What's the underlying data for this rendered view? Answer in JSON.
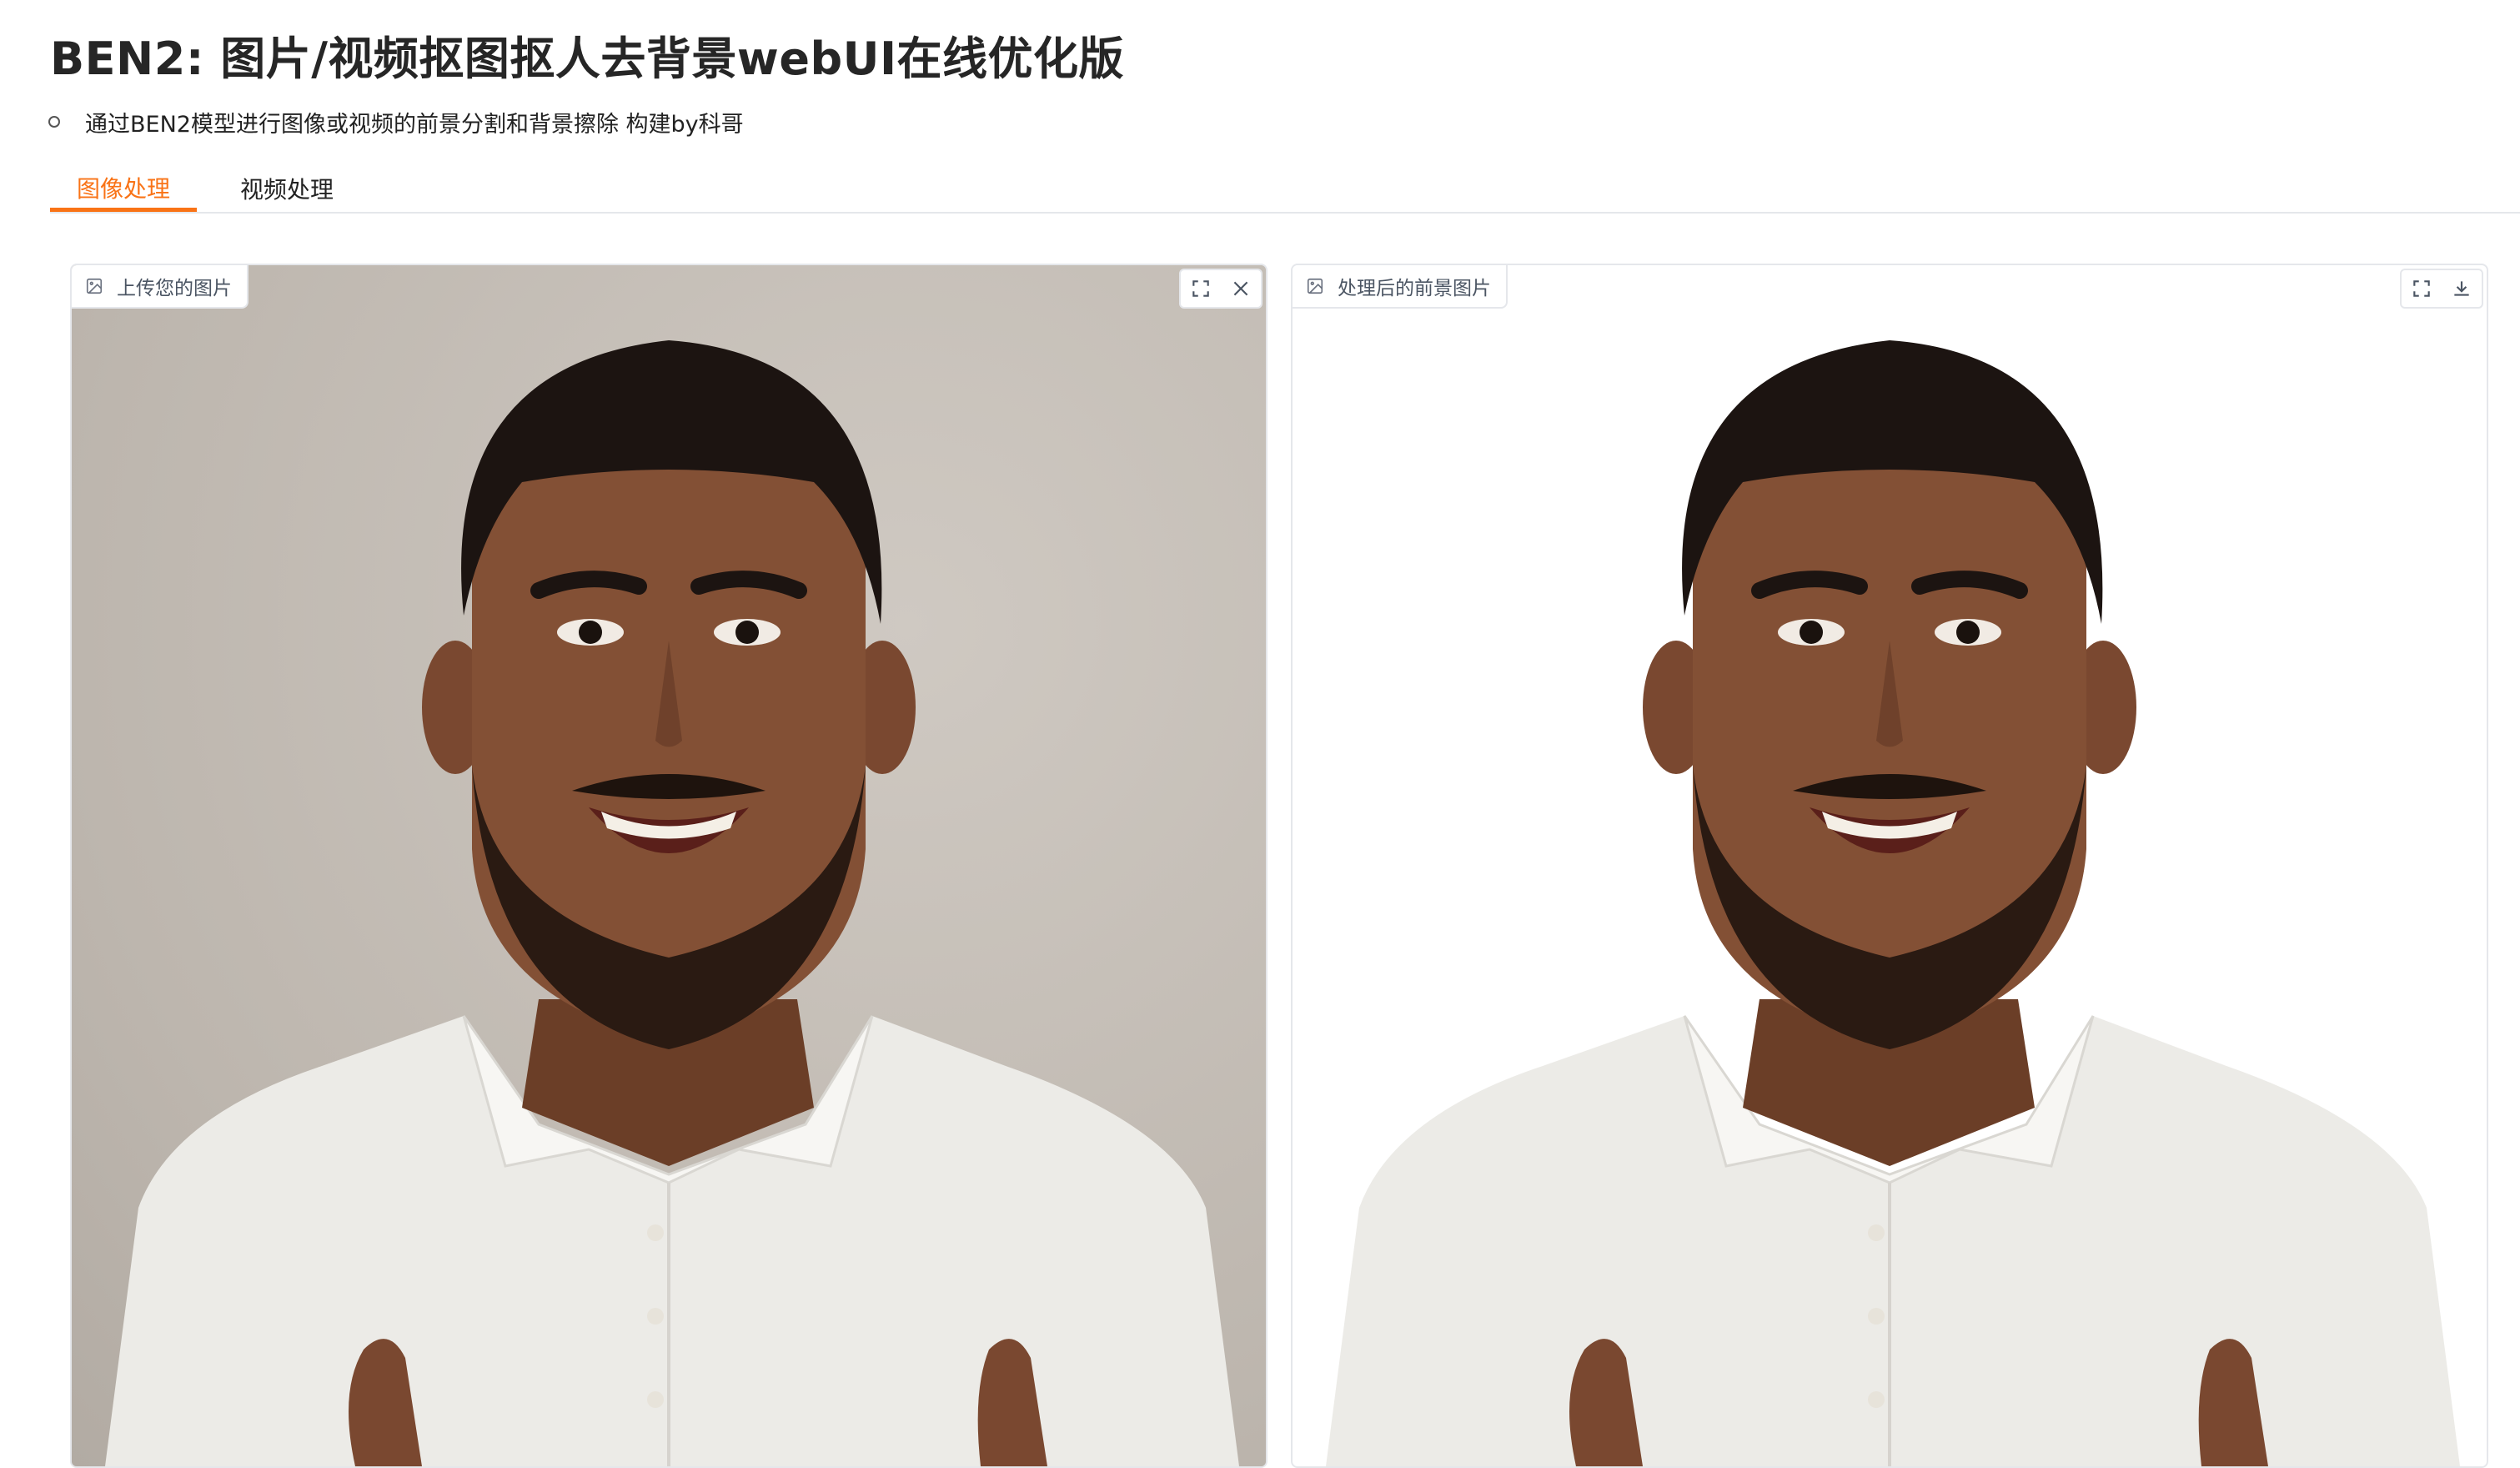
{
  "header": {
    "title": "BEN2: 图片/视频抠图抠人去背景webUI在线优化版",
    "description": "通过BEN2模型进行图像或视频的前景分割和背景擦除 构建by科哥"
  },
  "tabs": [
    {
      "label": "图像处理",
      "active": true
    },
    {
      "label": "视频处理",
      "active": false
    }
  ],
  "input_panel": {
    "label": "上传您的图片",
    "icon": "image-icon",
    "actions": [
      "fullscreen-icon",
      "close-icon"
    ]
  },
  "output_panel": {
    "label": "处理后的前景图片",
    "icon": "image-icon",
    "actions": [
      "fullscreen-icon",
      "download-icon"
    ]
  },
  "colors": {
    "accent": "#f97316",
    "input_background": "#c7c1ba",
    "output_background": "#ffffff"
  }
}
